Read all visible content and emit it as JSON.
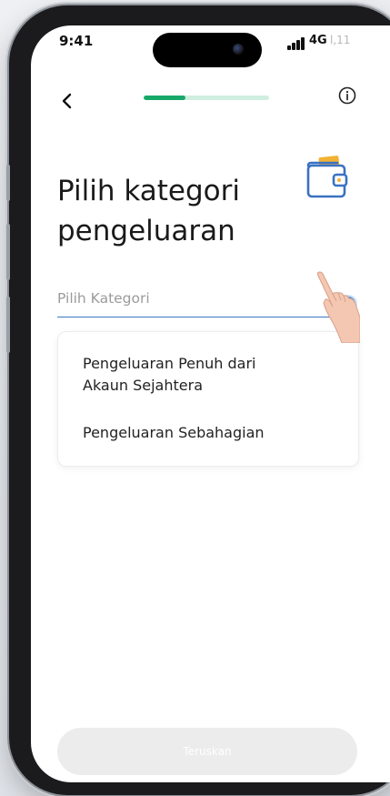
{
  "status_bar": {
    "time": "9:41",
    "network": "4G",
    "battery_label": "l,11"
  },
  "progress": {
    "fraction": 0.33,
    "accent_color": "#17a869",
    "track_color": "#cfeee0"
  },
  "nav": {
    "back_icon": "chevron-left-icon",
    "info_icon": "info-circle-icon"
  },
  "page": {
    "title_line1": "Pilih kategori",
    "title_line2": "pengeluaran",
    "illustration_icon": "wallet-icon"
  },
  "category_field": {
    "placeholder": "Pilih Kategori",
    "accent_color": "#3a78c6"
  },
  "dropdown": {
    "options": [
      {
        "line1": "Pengeluaran Penuh dari",
        "line2": "Akaun Sejahtera"
      },
      {
        "line1": "Pengeluaran Sebahagian"
      }
    ]
  },
  "footer": {
    "continue_label": "Teruskan",
    "continue_enabled": false
  }
}
